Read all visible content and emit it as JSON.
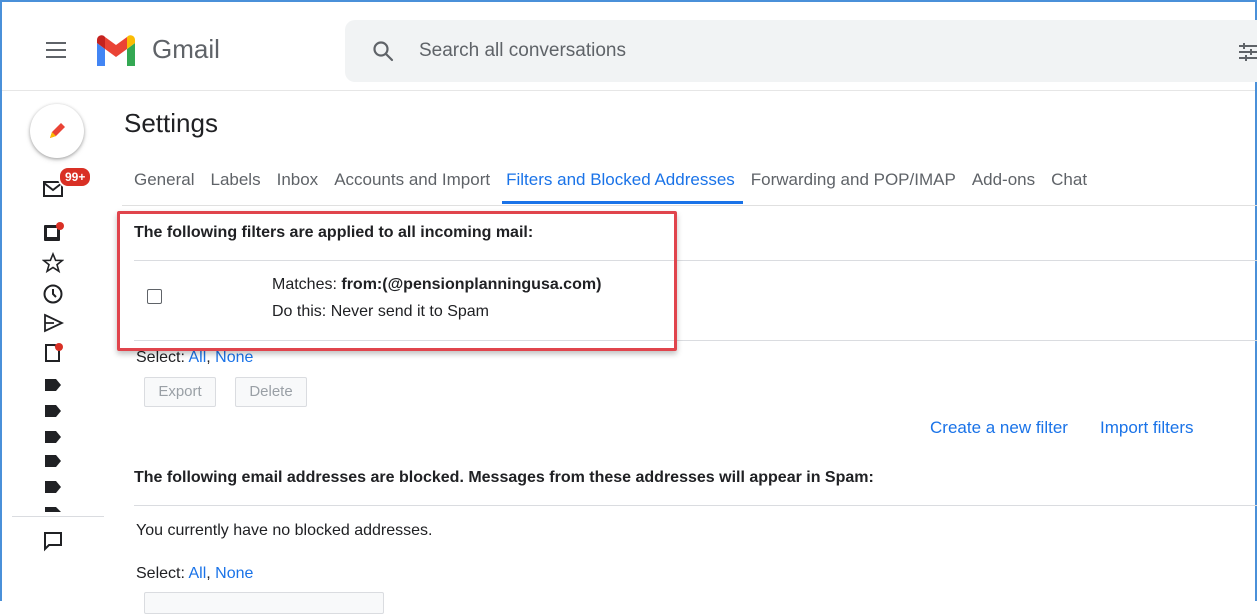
{
  "app": {
    "brand": "Gmail",
    "search_placeholder": "Search all conversations"
  },
  "sidebar": {
    "badge": "99+"
  },
  "settings": {
    "title": "Settings",
    "tabs": [
      {
        "label": "General",
        "active": false
      },
      {
        "label": "Labels",
        "active": false
      },
      {
        "label": "Inbox",
        "active": false
      },
      {
        "label": "Accounts and Import",
        "active": false
      },
      {
        "label": "Filters and Blocked Addresses",
        "active": true
      },
      {
        "label": "Forwarding and POP/IMAP",
        "active": false
      },
      {
        "label": "Add-ons",
        "active": false
      },
      {
        "label": "Chat",
        "active": false
      }
    ]
  },
  "filters": {
    "heading": "The following filters are applied to all incoming mail:",
    "items": [
      {
        "matches_label": "Matches: ",
        "matches_value": "from:(@pensionplanningusa.com)",
        "action": "Do this: Never send it to Spam",
        "checked": false
      }
    ],
    "select_label": "Select: ",
    "select_all": "All",
    "select_sep": ", ",
    "select_none": "None",
    "export_button": "Export",
    "delete_button": "Delete",
    "create_link": "Create a new filter",
    "import_link": "Import filters"
  },
  "blocked": {
    "heading": "The following email addresses are blocked. Messages from these addresses will appear in Spam:",
    "empty_text": "You currently have no blocked addresses.",
    "select_label": "Select: ",
    "select_all": "All",
    "select_sep": ", ",
    "select_none": "None"
  },
  "colors": {
    "accent": "#1a73e8",
    "badge": "#d93025",
    "highlight": "#e0444c"
  }
}
